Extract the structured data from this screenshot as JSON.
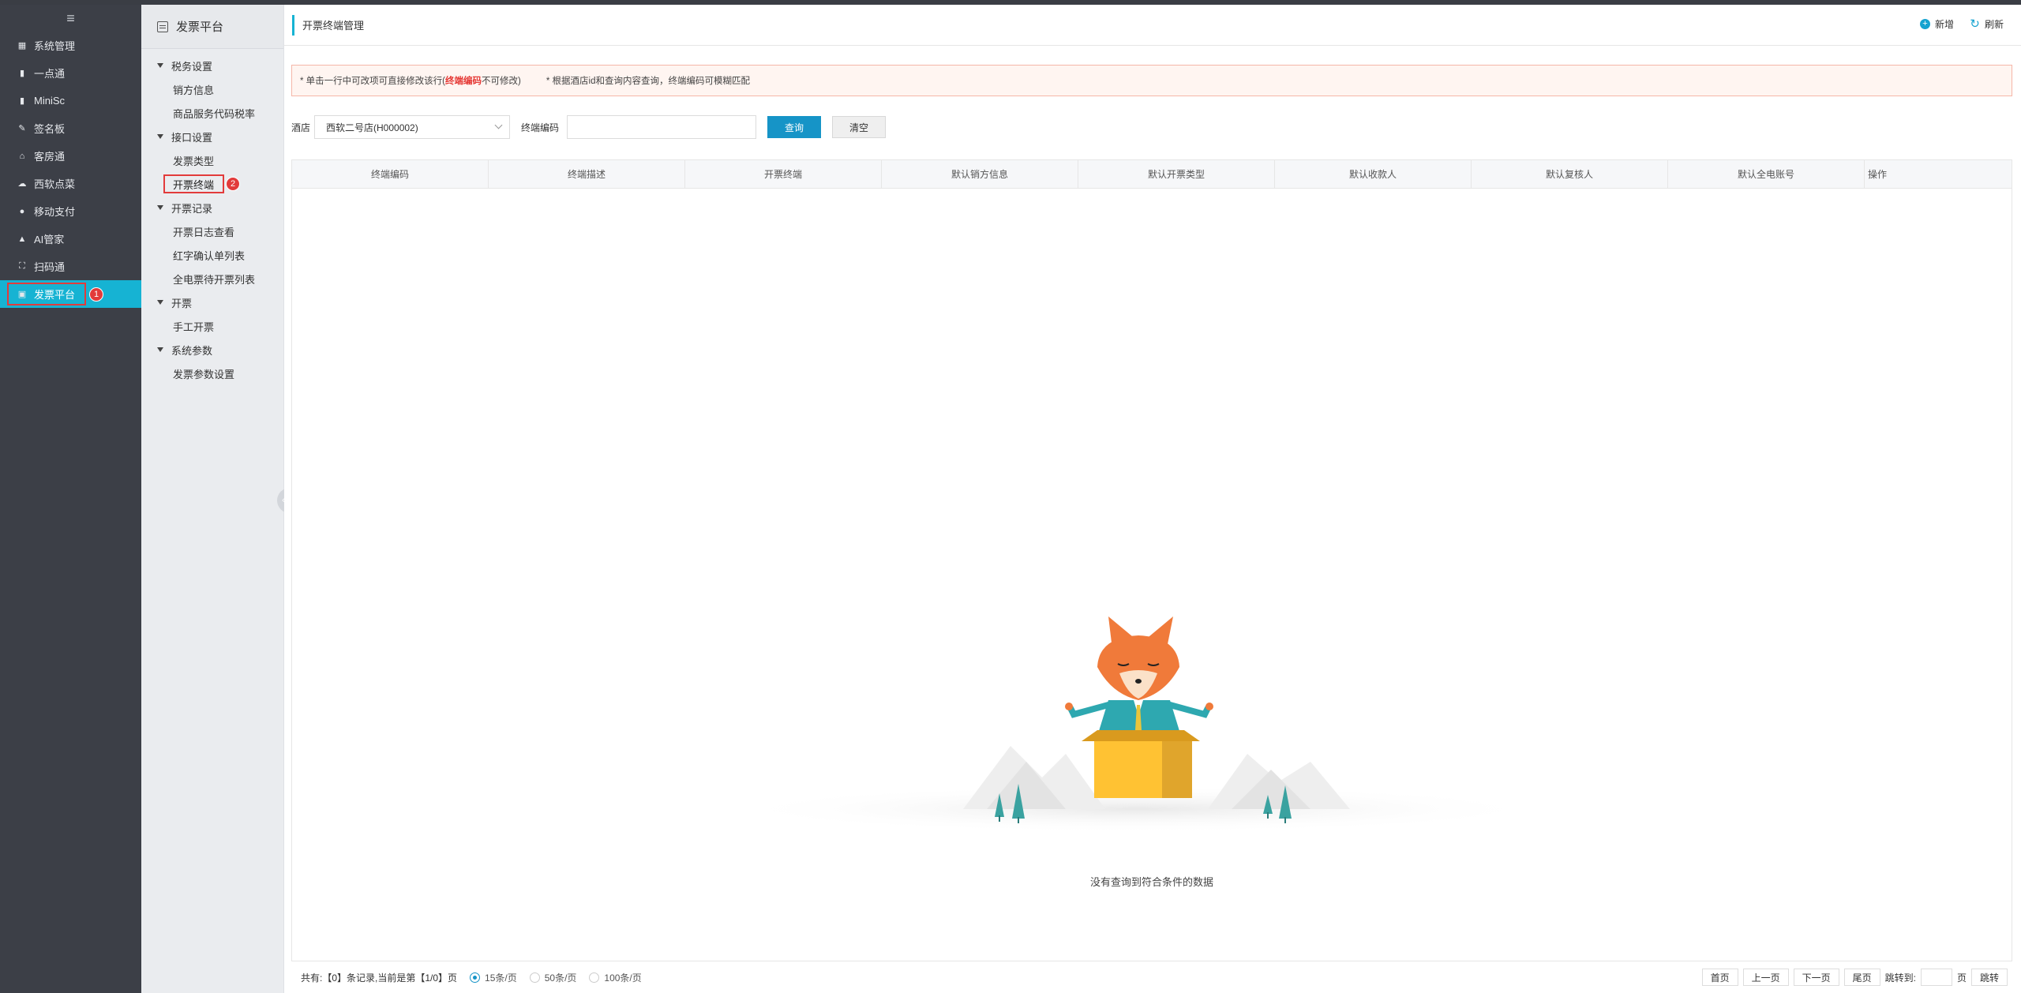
{
  "leftnav": {
    "items": [
      {
        "label": "系统管理",
        "icon": "grid-icon"
      },
      {
        "label": "一点通",
        "icon": "bar-chart-icon"
      },
      {
        "label": "MiniSc",
        "icon": "bar-chart-icon"
      },
      {
        "label": "签名板",
        "icon": "pen-icon"
      },
      {
        "label": "客房通",
        "icon": "home-icon"
      },
      {
        "label": "西软点菜",
        "icon": "cloud-icon"
      },
      {
        "label": "移动支付",
        "icon": "info-icon"
      },
      {
        "label": "AI管家",
        "icon": "car-icon"
      },
      {
        "label": "扫码通",
        "icon": "scan-icon"
      },
      {
        "label": "发票平台",
        "icon": "invoice-icon"
      }
    ],
    "badge1": "1"
  },
  "subnav": {
    "title": "发票平台",
    "groups": [
      {
        "label": "税务设置",
        "items": [
          "销方信息",
          "商品服务代码税率"
        ]
      },
      {
        "label": "接口设置",
        "items": [
          "发票类型",
          "开票终端"
        ]
      },
      {
        "label": "开票记录",
        "items": [
          "开票日志查看",
          "红字确认单列表",
          "全电票待开票列表"
        ]
      },
      {
        "label": "开票",
        "items": [
          "手工开票"
        ]
      },
      {
        "label": "系统参数",
        "items": [
          "发票参数设置"
        ]
      }
    ],
    "badge2": "2"
  },
  "header": {
    "title": "开票终端管理",
    "add_label": "新增",
    "refresh_label": "刷新"
  },
  "notice": {
    "part1": "* 单击一行中可改项可直接修改该行(",
    "red": "终端编码",
    "part2": "不可修改)",
    "part3": "* 根据酒店id和查询内容查询，终端编码可模糊匹配"
  },
  "filter": {
    "hotel_label": "酒店",
    "hotel_value": "西软二号店(H000002)",
    "code_label": "终端编码",
    "code_value": "",
    "query_label": "查询",
    "clear_label": "清空"
  },
  "table": {
    "columns": [
      "终端编码",
      "终端描述",
      "开票终端",
      "默认销方信息",
      "默认开票类型",
      "默认收款人",
      "默认复核人",
      "默认全电账号",
      "操作"
    ],
    "rows": [],
    "empty_text": "没有查询到符合条件的数据"
  },
  "footer": {
    "records": "共有:【0】条记录,当前是第【1/0】页",
    "page_sizes": [
      "15条/页",
      "50条/页",
      "100条/页"
    ],
    "selected_size": "15条/页",
    "first": "首页",
    "prev": "上一页",
    "next": "下一页",
    "last": "尾页",
    "jump_label": "跳转到:",
    "page_unit": "页",
    "jump_btn": "跳转"
  },
  "colors": {
    "accent": "#16b3d3",
    "primary_button": "#1694c7",
    "sidebar_bg": "#3c3f47",
    "highlight_red": "#e23b3b"
  }
}
